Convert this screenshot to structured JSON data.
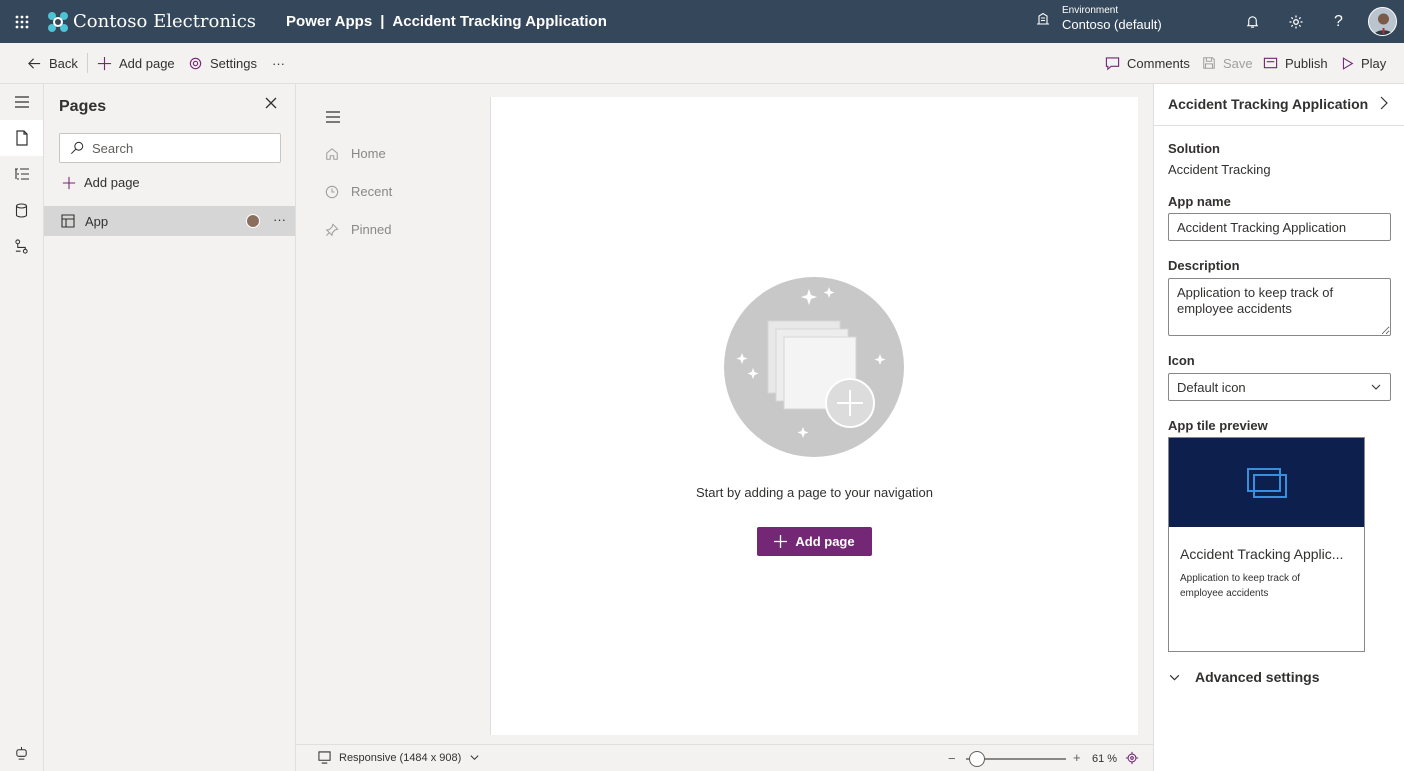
{
  "header": {
    "brand": "Contoso Electronics",
    "product": "Power Apps",
    "separator": "|",
    "app_title": "Accident Tracking Application",
    "environment_label": "Environment",
    "environment_value": "Contoso (default)",
    "colors": {
      "bar": "#35475a"
    }
  },
  "toolbar": {
    "back": "Back",
    "add_page": "Add page",
    "settings": "Settings",
    "more": "···",
    "comments": "Comments",
    "save": "Save",
    "publish": "Publish",
    "play": "Play"
  },
  "pages_panel": {
    "title": "Pages",
    "search_placeholder": "Search",
    "add_page": "Add page",
    "items": [
      {
        "label": "App",
        "more": "···"
      }
    ]
  },
  "canvas": {
    "nav_items": [
      "Home",
      "Recent",
      "Pinned"
    ],
    "empty_message": "Start by adding a page to your navigation",
    "add_page_button": "Add page",
    "accent_color": "#742774"
  },
  "status": {
    "layout": "Responsive (1484 x 908)",
    "zoom_minus": "−",
    "zoom_plus": "+",
    "zoom": "61 %",
    "zoom_level_fraction": 0.05
  },
  "properties": {
    "title": "Accident Tracking Application",
    "solution_label": "Solution",
    "solution_value": "Accident Tracking",
    "app_name_label": "App name",
    "app_name_value": "Accident Tracking Application",
    "description_label": "Description",
    "description_value": "Application to keep track of employee accidents",
    "icon_label": "Icon",
    "icon_value": "Default icon",
    "tile_preview_label": "App tile preview",
    "tile_name": "Accident Tracking Applic...",
    "tile_description": "Application to keep track of employee accidents",
    "advanced_settings": "Advanced settings",
    "tile_color": "#0c1f4d"
  }
}
